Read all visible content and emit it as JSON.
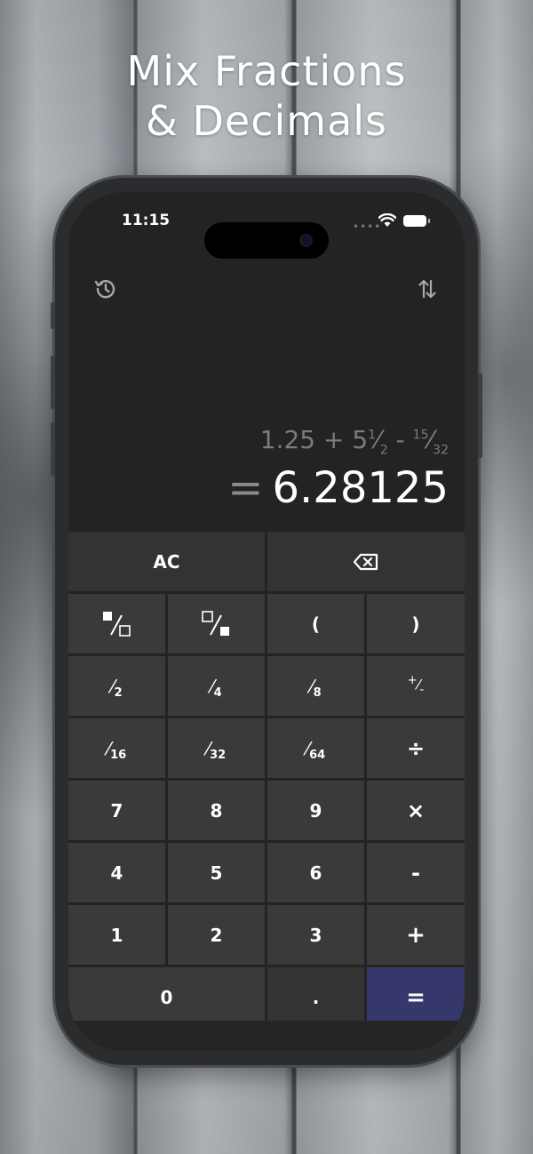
{
  "headline": {
    "line1": "Mix Fractions",
    "line2": "& Decimals"
  },
  "status_bar": {
    "time": "11:15"
  },
  "toolbar": {
    "history_icon": "history-icon",
    "swap_icon": "swap-vertical-icon"
  },
  "display": {
    "expression": {
      "a": "1.25",
      "op1": "+",
      "b_whole": "5",
      "b_num": "1",
      "b_den": "2",
      "op2": "-",
      "c_num": "15",
      "c_den": "32"
    },
    "equals_sign": "=",
    "result": "6.28125"
  },
  "keys": {
    "ac": "AC",
    "backspace_icon": "backspace-icon",
    "numerator_icon": "numerator-entry-icon",
    "denominator_icon": "denominator-entry-icon",
    "open_paren": "(",
    "close_paren": ")",
    "half": {
      "slash": "⁄",
      "den": "2"
    },
    "quarter": {
      "slash": "⁄",
      "den": "4"
    },
    "eighth": {
      "slash": "⁄",
      "den": "8"
    },
    "sign_toggle": {
      "top": "+",
      "slash": "⁄",
      "bottom": "-"
    },
    "sixteenth": {
      "slash": "⁄",
      "den": "16"
    },
    "thirtysecond": {
      "slash": "⁄",
      "den": "32"
    },
    "sixtyfourth": {
      "slash": "⁄",
      "den": "64"
    },
    "divide": "÷",
    "seven": "7",
    "eight": "8",
    "nine": "9",
    "multiply": "×",
    "four": "4",
    "five": "5",
    "six": "6",
    "minus": "-",
    "one": "1",
    "two": "2",
    "three": "3",
    "plus": "+",
    "zero": "0",
    "decimal": ".",
    "equals": "="
  },
  "colors": {
    "accent_equals": "#36376a",
    "key": "#3a3a3a",
    "screen": "#232323"
  }
}
